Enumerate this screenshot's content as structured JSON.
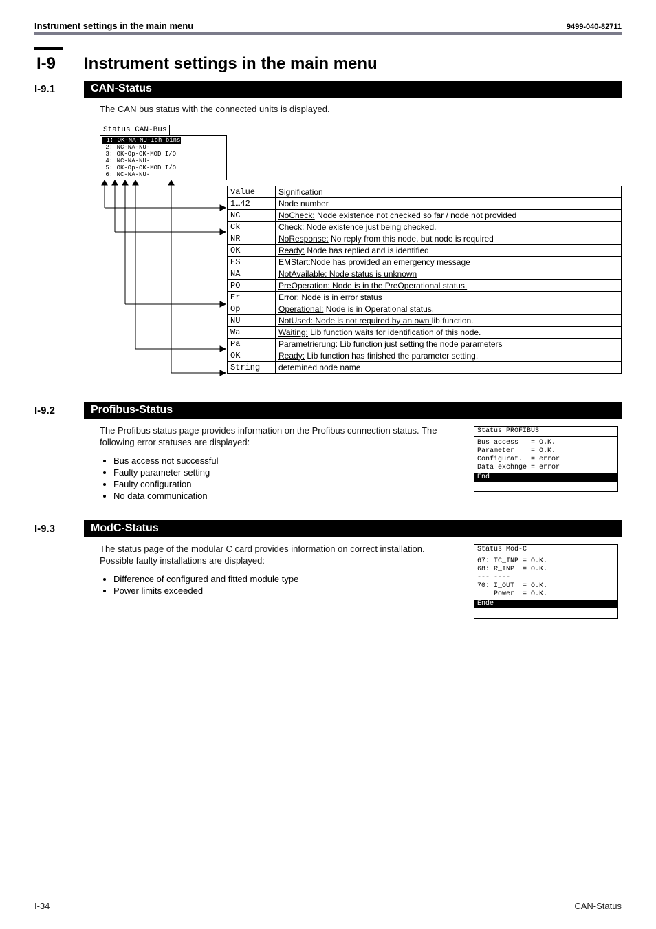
{
  "header": {
    "left": "Instrument settings in the main menu",
    "right": "9499-040-82711"
  },
  "chapter": {
    "tag": "I-9",
    "title": "Instrument settings in the main menu"
  },
  "can": {
    "num": "I-9.1",
    "bar": "CAN-Status",
    "intro": "The CAN bus status with the connected units is displayed.",
    "lcd_title": "Status CAN-Bus",
    "lcd_lines": [
      {
        "hl": true,
        "text": " 1: OK-NA-NU-Ich bins"
      },
      {
        "hl": false,
        "text": " 2: NC-NA-NU-"
      },
      {
        "hl": false,
        "text": " 3: OK-Op-OK-MOD I/O"
      },
      {
        "hl": false,
        "text": " 4: NC-NA-NU-"
      },
      {
        "hl": false,
        "text": " 5: OK-Op-OK-MOD I/O"
      },
      {
        "hl": false,
        "text": " 6: NC-NA-NU-"
      }
    ],
    "rows": [
      {
        "v": "Value",
        "s": "Signification"
      },
      {
        "v": "1…42",
        "s": "Node number"
      },
      {
        "v": "NC",
        "s_html": "<span class=\"ul\">NoCheck:</span> Node existence not checked so far / node not provided"
      },
      {
        "v": "Ck",
        "s_html": "<span class=\"ul\">Check:</span> Node existence just  being checked."
      },
      {
        "v": "NR",
        "s_html": "<span class=\"ul\">NoResponse:</span> No reply from this node, but node is required"
      },
      {
        "v": "OK",
        "s_html": "<span class=\"ul\">Ready:</span> Node has replied and is identified"
      },
      {
        "v": "ES",
        "s_html": "<span class=\"ul\">EMStart:Node has provided an emergency message</span>"
      },
      {
        "v": "NA",
        "s_html": "<span class=\"ul\">NotAvailable: Node status is unknown</span>"
      },
      {
        "v": "PO",
        "s_html": "<span class=\"ul\">PreOperation: Node is in the PreOperational status.</span>"
      },
      {
        "v": "Er",
        "s_html": "<span class=\"ul\">Error:</span> Node is in error status"
      },
      {
        "v": "Op",
        "s_html": "<span class=\"ul\">Operational:</span> Node is in Operational status."
      },
      {
        "v": "NU",
        "s_html": "<span class=\"ul\">NotUsed: Node is not required by an own </span>lib function."
      },
      {
        "v": "Wa",
        "s_html": "<span class=\"ul\">Waiting:</span> Lib function waits for identification of this node."
      },
      {
        "v": "Pa",
        "s_html": "<span class=\"ul\">Parametrierung: Lib function just setting the node parameters</span>"
      },
      {
        "v": "OK",
        "s_html": "<span class=\"ul\">Ready:</span> Lib function has finished the parameter setting."
      },
      {
        "v": "String",
        "s": "detemined node name"
      }
    ]
  },
  "profibus": {
    "num": "I-9.2",
    "bar": "Profibus-Status",
    "intro": "The Profibus status page provides information on  the Profibus connection status. The following error statuses are displayed:",
    "bullets": [
      "Bus access not successful",
      "Faulty parameter setting",
      "Faulty configuration",
      "No data communication"
    ],
    "lcd_title": "Status PROFIBUS",
    "lcd_body": "Bus access   = O.K.\nParameter    = O.K.\nConfigurat.  = error\nData exchnge = error",
    "lcd_hl": "End"
  },
  "modc": {
    "num": "I-9.3",
    "bar": "ModC-Status",
    "intro": "The status page of the modular C card provides information on correct installation. Possible faulty installations are displayed:",
    "bullets": [
      "Difference of configured and fitted module type",
      "Power limits exceeded"
    ],
    "lcd_title": "Status Mod-C",
    "lcd_body": "67: TC_INP = O.K.\n68: R_INP  = O.K.\n--- ----\n70: I_OUT  = O.K.\n    Power  = O.K.",
    "lcd_hl": "Ende"
  },
  "footer": {
    "left": "I-34",
    "right": "CAN-Status"
  }
}
